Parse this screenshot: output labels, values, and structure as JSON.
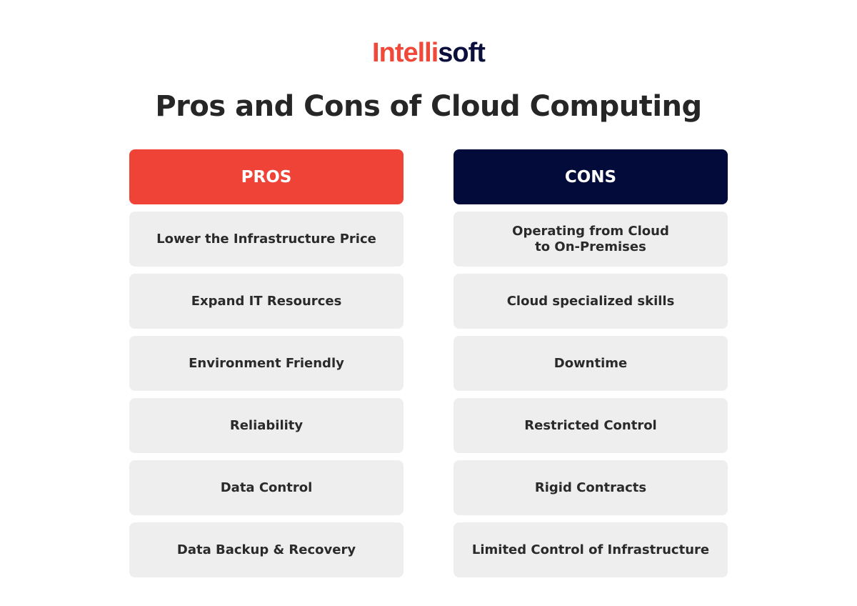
{
  "brand": {
    "name_part1": "Intelli",
    "name_part2": "soft",
    "color_primary": "#f0493a",
    "color_secondary": "#0b0f3c"
  },
  "title": "Pros and Cons of Cloud Computing",
  "pros": {
    "header": "PROS",
    "color": "#ef4338",
    "items": [
      "Lower the Infrastructure Price",
      "Expand IT Resources",
      "Environment Friendly",
      "Reliability",
      "Data Control",
      "Data Backup & Recovery"
    ]
  },
  "cons": {
    "header": "CONS",
    "color": "#020b3a",
    "items": [
      "Operating from Cloud\nto On-Premises",
      "Cloud specialized skills",
      "Downtime",
      "Restricted Control",
      "Rigid Contracts",
      "Limited Control of Infrastructure"
    ]
  }
}
